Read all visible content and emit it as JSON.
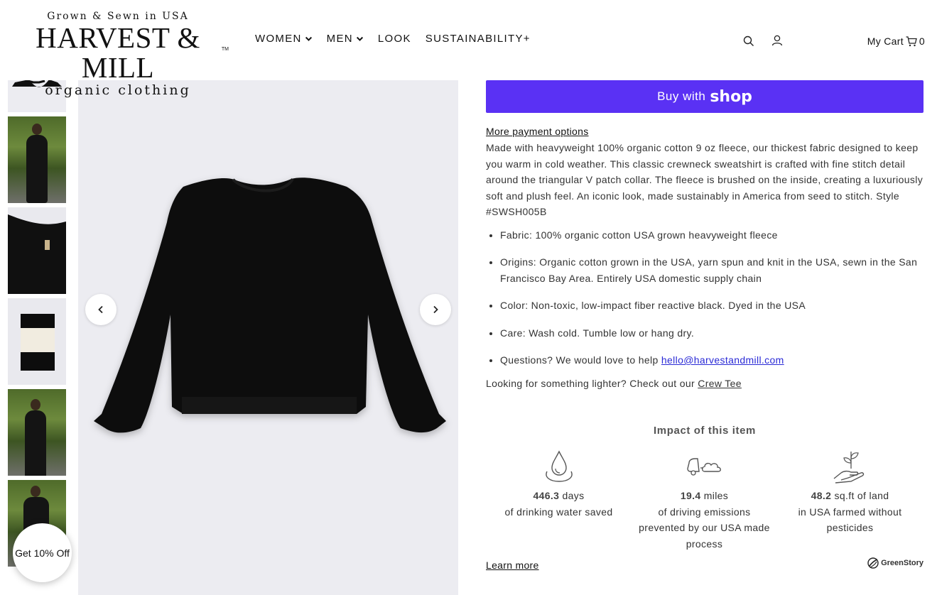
{
  "logo": {
    "tagline": "Grown & Sewn in USA",
    "brand": "HARVEST & MILL",
    "subtitle": "organic clothing",
    "tm": "TM"
  },
  "nav": {
    "items": [
      {
        "label": "WOMEN",
        "dropdown": true
      },
      {
        "label": "MEN",
        "dropdown": true
      },
      {
        "label": "LOOK",
        "dropdown": false
      },
      {
        "label": "SUSTAINABILITY+",
        "dropdown": false
      }
    ]
  },
  "header": {
    "cart_label": "My Cart",
    "cart_count": "0",
    "icons": [
      "search-icon",
      "account-icon",
      "cart-icon"
    ]
  },
  "product": {
    "buy_with": "Buy with",
    "shop": "shop",
    "more_payment": "More payment options",
    "description": "Made with heavyweight 100% organic cotton 9 oz fleece, our thickest fabric designed to keep you warm in cold weather. This classic crewneck sweatshirt is crafted with fine stitch detail around the triangular V patch collar. The fleece is brushed on the inside, creating a luxuriously soft and plush feel. An iconic look, made sustainably in America from seed to stitch. Style #SWSH005B",
    "bullets": [
      "Fabric: 100% organic cotton USA grown heavyweight fleece",
      "Origins: Organic cotton grown in the USA, yarn spun and knit in the USA, sewn in the San Francisco Bay Area. Entirely USA domestic supply chain",
      "Color: Non-toxic, low-impact fiber reactive black. Dyed in the USA",
      "Care: Wash cold. Tumble low or hang dry."
    ],
    "questions_text": "Questions? We would love to help ",
    "email": "hello@harvestandmill.com",
    "lighter_text": "Looking for something lighter? Check out our ",
    "crew_tee": "Crew Tee"
  },
  "impact": {
    "title": "Impact of this item",
    "items": [
      {
        "value": "446.3",
        "unit": " days",
        "line2": "of drinking water saved",
        "line3": "",
        "icon": "water-drop-icon"
      },
      {
        "value": "19.4",
        "unit": " miles",
        "line2": "of driving emissions",
        "line3": "prevented by our USA made process",
        "icon": "car-emissions-icon"
      },
      {
        "value": "48.2",
        "unit": " sq.ft of land",
        "line2": "in USA farmed without pesticides",
        "line3": "",
        "icon": "hand-plant-icon"
      }
    ],
    "learn_more": "Learn more",
    "greenstory": "GreenStory"
  },
  "discount": {
    "label": "Get 10% Off"
  },
  "colors": {
    "shop_pay": "#5a31f4",
    "link": "#2a2ad6",
    "image_bg": "#ececf1"
  }
}
